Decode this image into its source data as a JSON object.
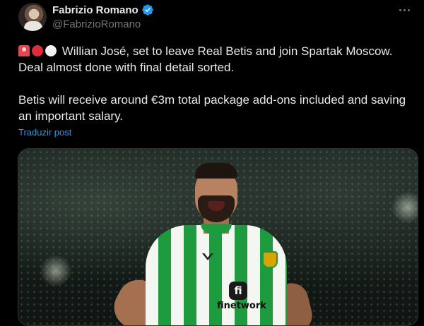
{
  "author": {
    "display_name": "Fabrizio Romano",
    "handle": "@FabrizioRomano",
    "verified": true,
    "verified_color": "#1d9bf0"
  },
  "tweet": {
    "line1_emojis": [
      "siren-emoji",
      "red-circle-emoji",
      "white-circle-emoji"
    ],
    "line1": "Willian José, set to leave Real Betis and join Spartak Moscow.",
    "line2": "Deal almost done with final detail sorted.",
    "line3": "Betis will receive around €3m total package add-ons included and saving an important salary."
  },
  "translate_label": "Traduzir post",
  "media": {
    "sponsor_logo_text": "fi",
    "sponsor_name": "finetwork"
  },
  "colors": {
    "background": "#000000",
    "text": "#e7e9ea",
    "muted": "#71767b",
    "link": "#1d9bf0"
  }
}
